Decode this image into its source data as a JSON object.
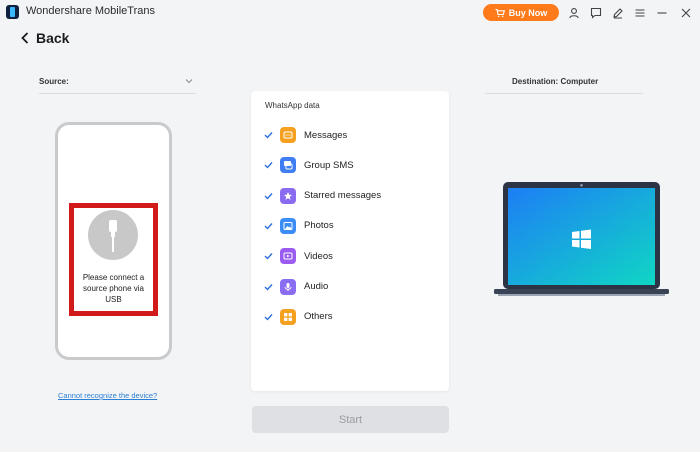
{
  "titlebar": {
    "app_title": "Wondershare MobileTrans",
    "buy_label": "Buy Now",
    "icons": [
      "account-icon",
      "feedback-icon",
      "edit-icon",
      "menu-icon",
      "minimize-icon",
      "close-icon"
    ]
  },
  "nav": {
    "back_label": "Back"
  },
  "source": {
    "label": "Source:",
    "connect_message": "Please connect a source phone via USB",
    "help_link": "Cannot recognize the device?"
  },
  "destination": {
    "label": "Destination: Computer"
  },
  "data_panel": {
    "title": "WhatsApp data",
    "items": [
      {
        "label": "Messages",
        "checked": true,
        "icon": "messages-icon",
        "color": "#f5a020"
      },
      {
        "label": "Group SMS",
        "checked": true,
        "icon": "group-sms-icon",
        "color": "#3e7ef2"
      },
      {
        "label": "Starred messages",
        "checked": true,
        "icon": "starred-messages-icon",
        "color": "#8a6cf0"
      },
      {
        "label": "Photos",
        "checked": true,
        "icon": "photos-icon",
        "color": "#3b8df5"
      },
      {
        "label": "Videos",
        "checked": true,
        "icon": "videos-icon",
        "color": "#9a5cf0"
      },
      {
        "label": "Audio",
        "checked": true,
        "icon": "audio-icon",
        "color": "#8b6df2"
      },
      {
        "label": "Others",
        "checked": true,
        "icon": "others-icon",
        "color": "#f5a020"
      }
    ]
  },
  "actions": {
    "start_label": "Start"
  },
  "colors": {
    "accent": "#ff7a1a",
    "check": "#2a6fdb",
    "highlight": "#d11a1a",
    "link": "#2b7fd4"
  }
}
